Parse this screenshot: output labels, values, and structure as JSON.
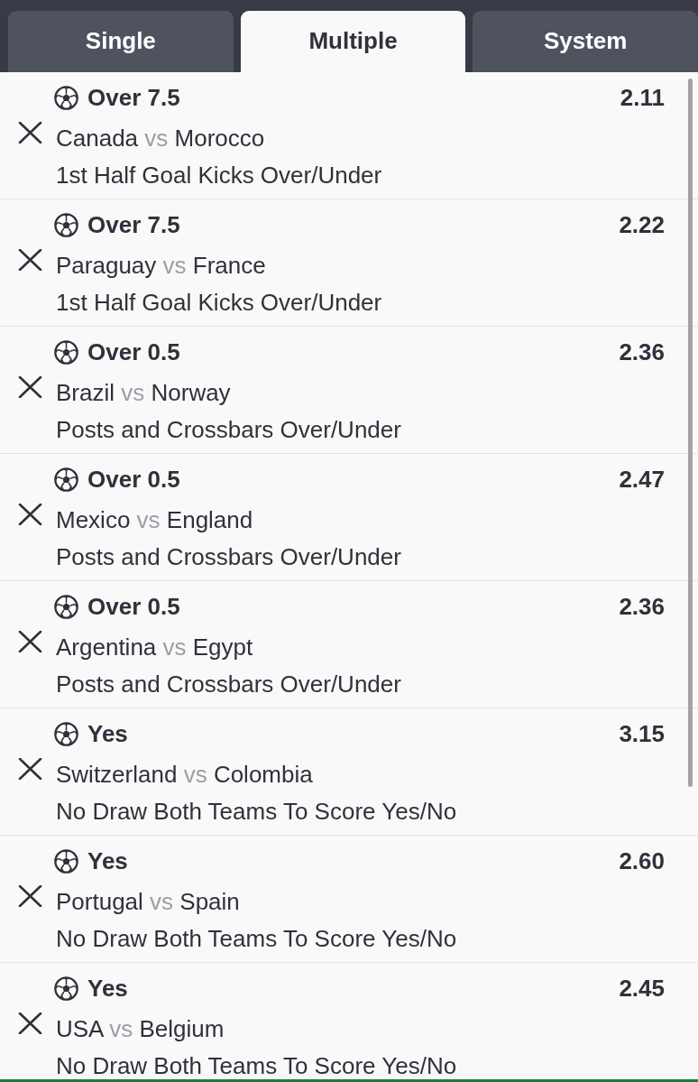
{
  "tabs": [
    {
      "label": "Single",
      "selected": false
    },
    {
      "label": "Multiple",
      "selected": true
    },
    {
      "label": "System",
      "selected": false
    }
  ],
  "bets": [
    {
      "selection": "Over 7.5",
      "odds": "2.11",
      "home": "Canada",
      "separator": "vs",
      "away": "Morocco",
      "market": "1st Half Goal Kicks Over/Under"
    },
    {
      "selection": "Over 7.5",
      "odds": "2.22",
      "home": "Paraguay",
      "separator": "vs",
      "away": "France",
      "market": "1st Half Goal Kicks Over/Under"
    },
    {
      "selection": "Over 0.5",
      "odds": "2.36",
      "home": "Brazil",
      "separator": "vs",
      "away": "Norway",
      "market": "Posts and Crossbars Over/Under"
    },
    {
      "selection": "Over 0.5",
      "odds": "2.47",
      "home": "Mexico",
      "separator": "vs",
      "away": "England",
      "market": "Posts and Crossbars Over/Under"
    },
    {
      "selection": "Over 0.5",
      "odds": "2.36",
      "home": "Argentina",
      "separator": "vs",
      "away": "Egypt",
      "market": "Posts and Crossbars Over/Under"
    },
    {
      "selection": "Yes",
      "odds": "3.15",
      "home": "Switzerland",
      "separator": "vs",
      "away": "Colombia",
      "market": "No Draw Both Teams To Score Yes/No"
    },
    {
      "selection": "Yes",
      "odds": "2.60",
      "home": "Portugal",
      "separator": "vs",
      "away": "Spain",
      "market": "No Draw Both Teams To Score Yes/No"
    },
    {
      "selection": "Yes",
      "odds": "2.45",
      "home": "USA",
      "separator": "vs",
      "away": "Belgium",
      "market": "No Draw Both Teams To Score Yes/No"
    }
  ]
}
